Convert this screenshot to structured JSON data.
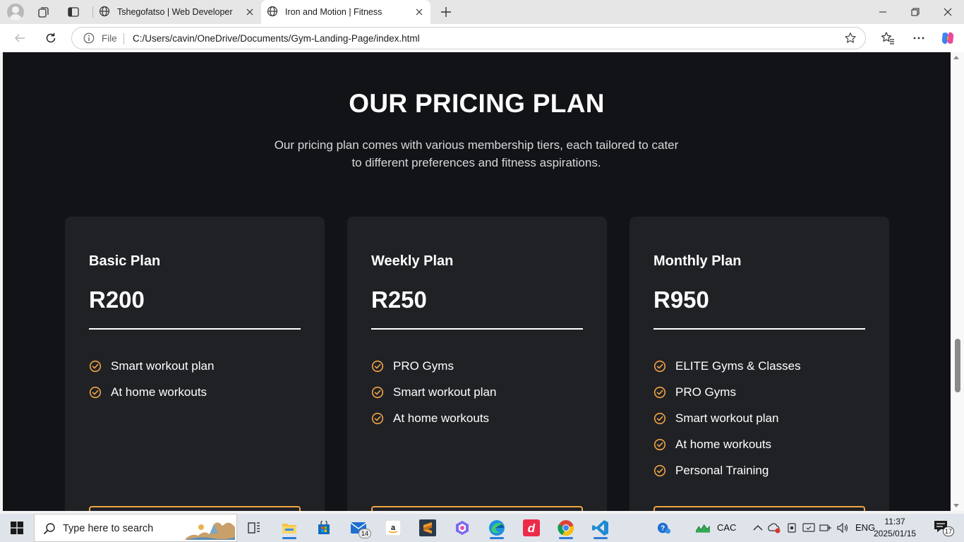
{
  "browser": {
    "tabs": [
      {
        "title": "Tshegofatso | Web Developer",
        "active": false
      },
      {
        "title": "Iron and Motion | Fitness",
        "active": true
      }
    ],
    "address": {
      "scheme_label": "File",
      "url": "C:/Users/cavin/OneDrive/Documents/Gym-Landing-Page/index.html"
    }
  },
  "page": {
    "pricing": {
      "title": "OUR PRICING PLAN",
      "subtitle": "Our pricing plan comes with various membership tiers, each tailored to cater to different preferences and fitness aspirations.",
      "plans": [
        {
          "name": "Basic Plan",
          "price": "R200",
          "features": [
            "Smart workout plan",
            "At home workouts"
          ]
        },
        {
          "name": "Weekly Plan",
          "price": "R250",
          "features": [
            "PRO Gyms",
            "Smart workout plan",
            "At home workouts"
          ]
        },
        {
          "name": "Monthly Plan",
          "price": "R950",
          "features": [
            "ELITE Gyms & Classes",
            "PRO Gyms",
            "Smart workout plan",
            "At home workouts",
            "Personal Training"
          ]
        }
      ]
    }
  },
  "colors": {
    "page_bg": "#111317",
    "card_bg": "#1f2125",
    "accent": "#f2a343",
    "text": "#ffffff"
  },
  "taskbar": {
    "search_placeholder": "Type here to search",
    "mail_badge": "14",
    "weather_text": "CAC",
    "language": "ENG",
    "time": "11:37",
    "date": "2025/01/15",
    "notifications": "17"
  }
}
